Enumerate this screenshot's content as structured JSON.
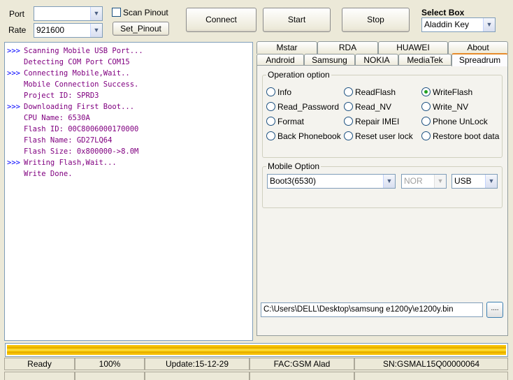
{
  "top": {
    "port_label": "Port",
    "rate_label": "Rate",
    "port_value": "",
    "rate_value": "921600",
    "scan_pinout_label": "Scan Pinout",
    "set_pinout_label": "Set_Pinout",
    "connect_label": "Connect",
    "start_label": "Start",
    "stop_label": "Stop",
    "select_box_label": "Select Box",
    "select_box_value": "Aladdin Key"
  },
  "log": [
    {
      "prefix": ">>>",
      "text": "Scanning Mobile USB Port..."
    },
    {
      "prefix": "",
      "text": "Detecting COM Port COM15"
    },
    {
      "prefix": ">>>",
      "text": "Connecting Mobile,Wait.."
    },
    {
      "prefix": "",
      "text": "Mobile Connection Success."
    },
    {
      "prefix": "",
      "text": "Project ID: SPRD3"
    },
    {
      "prefix": ">>>",
      "text": "Downloading First Boot..."
    },
    {
      "prefix": "",
      "text": "CPU Name: 6530A"
    },
    {
      "prefix": "",
      "text": "Flash ID: 00C8006000170000"
    },
    {
      "prefix": "",
      "text": "Flash Name: GD27LQ64"
    },
    {
      "prefix": "",
      "text": "Flash Size: 0x800000->8.0M"
    },
    {
      "prefix": ">>>",
      "text": "Writing Flash,Wait..."
    },
    {
      "prefix": "",
      "text": "Write Done."
    }
  ],
  "tabs_row1": [
    "Mstar",
    "RDA",
    "HUAWEI",
    "About"
  ],
  "tabs_row2": [
    "Android",
    "Samsung",
    "NOKIA",
    "MediaTek",
    "Spreadrum"
  ],
  "active_tab": "Spreadrum",
  "operation": {
    "title": "Operation option",
    "options": [
      "Info",
      "ReadFlash",
      "WriteFlash",
      "Read_Password",
      "Read_NV",
      "Write_NV",
      "Format",
      "Repair IMEI",
      "Phone UnLock",
      "Back Phonebook",
      "Reset user lock",
      "Restore boot data"
    ],
    "selected": "WriteFlash"
  },
  "mobile_option": {
    "title": "Mobile Option",
    "boot_value": "Boot3(6530)",
    "flash_type_value": "NOR",
    "connection_value": "USB"
  },
  "file_path": "C:\\Users\\DELL\\Desktop\\samsung e1200y\\e1200y.bin",
  "browse_label": "....",
  "progress_fraction": 1.0,
  "status": {
    "state": "Ready",
    "percent": "100%",
    "update": "Update:15-12-29",
    "fac": "FAC:GSM Alad",
    "sn": "SN:GSMAL15Q00000064"
  },
  "colors": {
    "log_prefix": "#0000ff",
    "log_text": "#800080",
    "progress": "#f7c200",
    "active_tab_accent": "#e68b2c",
    "radio_selected": "#21a121"
  }
}
